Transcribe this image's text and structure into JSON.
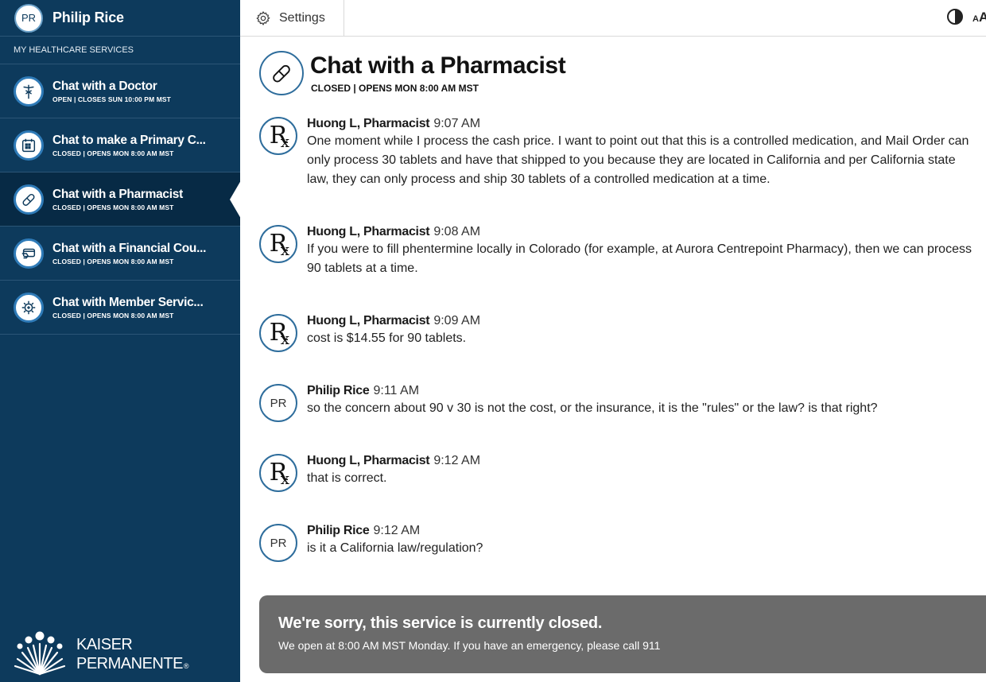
{
  "user": {
    "initials": "PR",
    "name": "Philip Rice"
  },
  "sidebar": {
    "section_label": "MY HEALTHCARE SERVICES",
    "items": [
      {
        "title": "Chat with a Doctor",
        "status": "OPEN | CLOSES SUN 10:00 PM MST",
        "icon": "caduceus-icon"
      },
      {
        "title": "Chat to make a Primary C...",
        "status": "CLOSED | OPENS MON 8:00 AM MST",
        "icon": "calendar-icon"
      },
      {
        "title": "Chat with a Pharmacist",
        "status": "CLOSED | OPENS MON 8:00 AM MST",
        "icon": "pill-icon"
      },
      {
        "title": "Chat with a Financial Cou...",
        "status": "CLOSED | OPENS MON 8:00 AM MST",
        "icon": "card-icon"
      },
      {
        "title": "Chat with Member Servic...",
        "status": "CLOSED | OPENS MON 8:00 AM MST",
        "icon": "gear-cross-icon"
      }
    ],
    "active_index": 2
  },
  "logo": {
    "line1": "KAISER",
    "line2": "PERMANENTE",
    "mark": "®"
  },
  "topbar": {
    "settings_label": "Settings",
    "font_size_label": "A",
    "font_size_label_large": "A"
  },
  "header": {
    "title": "Chat with a Pharmacist",
    "status": "CLOSED | OPENS MON 8:00 AM MST"
  },
  "messages": [
    {
      "author": "Huong L, Pharmacist",
      "time": "9:07 AM",
      "avatar": "rx",
      "text": "One moment while I process the cash price. I want to point out that this is a controlled medication, and Mail Order can only process 30 tablets and have that shipped to you because they are located in California and per California state law, they can only process and ship 30 tablets of a controlled medication at a time."
    },
    {
      "author": "Huong L, Pharmacist",
      "time": "9:08 AM",
      "avatar": "rx",
      "text": "If you were to fill phentermine locally in Colorado (for example, at Aurora Centrepoint Pharmacy), then we can process 90 tablets at a time."
    },
    {
      "author": "Huong L, Pharmacist",
      "time": "9:09 AM",
      "avatar": "rx",
      "text": "cost is $14.55 for 90 tablets."
    },
    {
      "author": "Philip Rice",
      "time": "9:11 AM",
      "avatar": "PR",
      "text": "so the concern about 90 v 30 is not the cost, or the insurance, it is the \"rules\" or the law? is that right?"
    },
    {
      "author": "Huong L, Pharmacist",
      "time": "9:12 AM",
      "avatar": "rx",
      "text": "that is correct."
    },
    {
      "author": "Philip Rice",
      "time": "9:12 AM",
      "avatar": "PR",
      "text": "is it a California law/regulation?"
    }
  ],
  "rx_symbol": {
    "r": "R",
    "x": "x"
  },
  "closed_banner": {
    "title": "We're sorry, this service is currently closed.",
    "text": "We open at 8:00 AM MST Monday. If you have an emergency, please call 911"
  },
  "colors": {
    "sidebar": "#0d3a5c",
    "active": "#072a45",
    "accent": "#2f7bb8",
    "banner": "#6b6b6b"
  }
}
